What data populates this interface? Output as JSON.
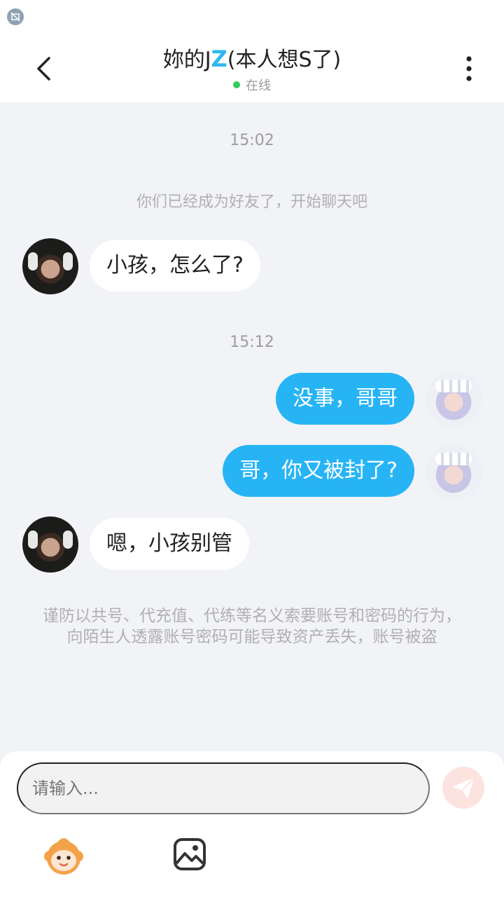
{
  "header": {
    "title_prefix": "妳的J",
    "title_z": "Z",
    "title_suffix": "(本人想S了)",
    "status": "在线"
  },
  "messages": {
    "time_1": "15:02",
    "system_notice": "你们已经成为好友了，开始聊天吧",
    "msg_1": "小孩，怎么了?",
    "time_2": "15:12",
    "msg_2": "没事，哥哥",
    "msg_3": "哥，你又被封了?",
    "msg_4": "嗯，小孩别管",
    "warning": "谨防以共号、代充值、代练等名义索要账号和密码的行为，向陌生人透露账号密码可能导致资产丢失，账号被盗"
  },
  "composer": {
    "placeholder": "请输入..."
  },
  "icons": {
    "back": "chevron-left-icon",
    "more": "more-vertical-icon",
    "send": "send-icon",
    "emoji": "emoji-mascot-icon",
    "image": "image-icon"
  },
  "colors": {
    "accent": "#27b4f5",
    "online": "#2fcc5a",
    "background": "#f2f3f7"
  }
}
